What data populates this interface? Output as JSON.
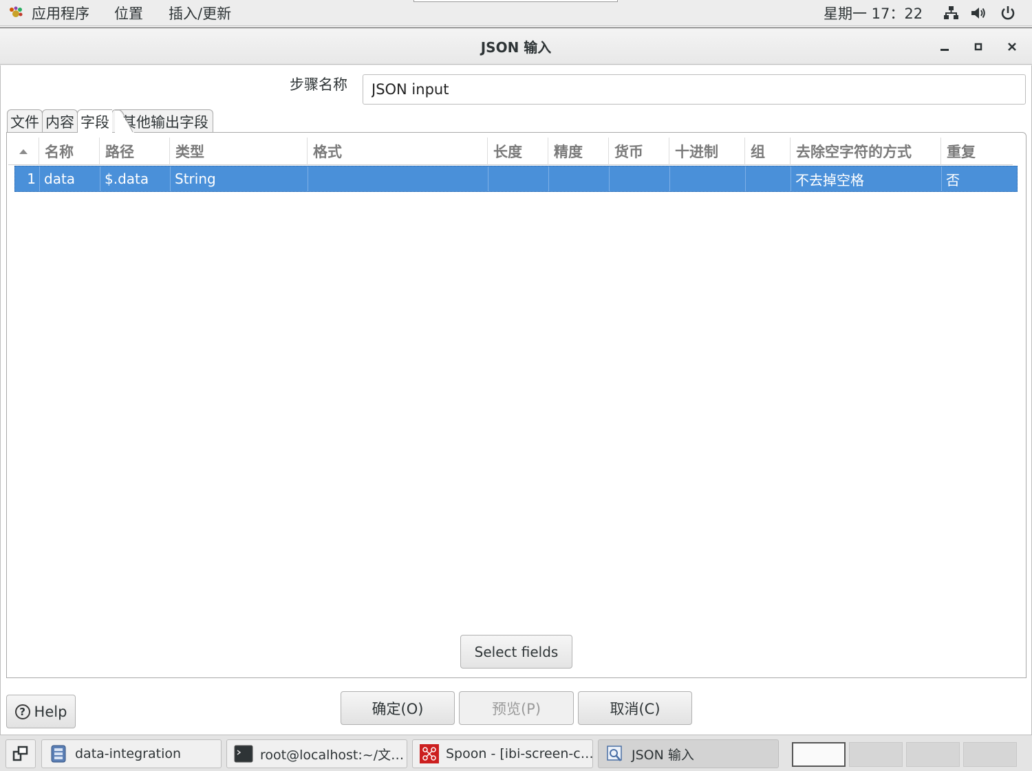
{
  "top_panel": {
    "menus": [
      "应用程序",
      "位置",
      "插入/更新"
    ],
    "clock": "星期一 17：22",
    "tray_icons": [
      "network-icon",
      "volume-icon",
      "power-icon"
    ]
  },
  "window": {
    "title": "JSON 输入",
    "controls": [
      "minimize",
      "maximize",
      "close"
    ]
  },
  "step": {
    "label": "步骤名称",
    "value": "JSON input"
  },
  "tabs": [
    {
      "label": "文件",
      "active": false
    },
    {
      "label": "内容",
      "active": false
    },
    {
      "label": "字段",
      "active": true
    },
    {
      "label": "其他输出字段",
      "active": false
    }
  ],
  "table": {
    "headers": [
      "名称",
      "路径",
      "类型",
      "格式",
      "长度",
      "精度",
      "货币",
      "十进制",
      "组",
      "去除空字符的方式",
      "重复"
    ],
    "rows": [
      {
        "num": "1",
        "cells": [
          "data",
          "$.data",
          "String",
          "",
          "",
          "",
          "",
          "",
          "",
          "不去掉空格",
          "否"
        ]
      }
    ]
  },
  "buttons": {
    "select_fields": "Select fields",
    "ok": "确定(O)",
    "preview": "预览(P)",
    "cancel": "取消(C)",
    "help": "Help"
  },
  "taskbar": {
    "tasks": [
      {
        "label": "data-integration",
        "icon": "file-manager-icon"
      },
      {
        "label": "root@localhost:~/文…",
        "icon": "terminal-icon"
      },
      {
        "label": "Spoon - [ibi-screen-c…",
        "icon": "spoon-icon"
      },
      {
        "label": "JSON 输入",
        "icon": "dialog-icon"
      }
    ]
  }
}
